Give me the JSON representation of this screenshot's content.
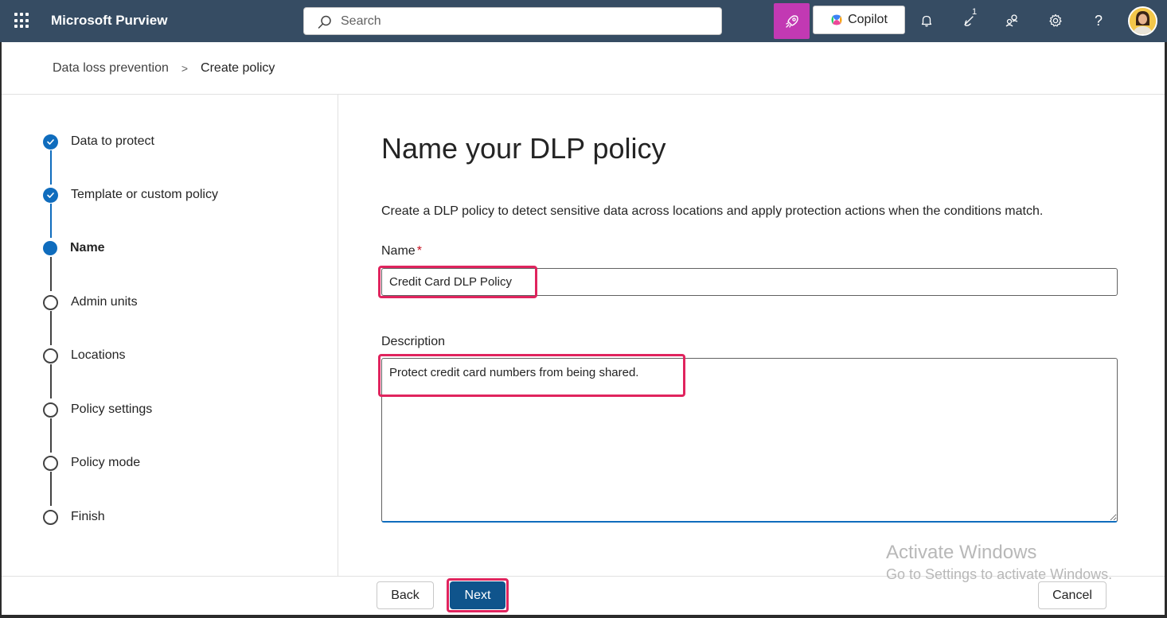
{
  "header": {
    "app_name": "Microsoft Purview",
    "search_placeholder": "Search",
    "copilot_label": "Copilot",
    "notification_badge": "1",
    "accent_color": "#c239b3"
  },
  "breadcrumb": {
    "items": [
      "Data loss prevention",
      "Create policy"
    ],
    "separator": ">"
  },
  "wizard": {
    "steps": [
      {
        "label": "Data to protect",
        "status": "completed"
      },
      {
        "label": "Template or custom policy",
        "status": "completed"
      },
      {
        "label": "Name",
        "status": "current"
      },
      {
        "label": "Admin units",
        "status": "pending"
      },
      {
        "label": "Locations",
        "status": "pending"
      },
      {
        "label": "Policy settings",
        "status": "pending"
      },
      {
        "label": "Policy mode",
        "status": "pending"
      },
      {
        "label": "Finish",
        "status": "pending"
      }
    ]
  },
  "main": {
    "title": "Name your DLP policy",
    "description": "Create a DLP policy to detect sensitive data across locations and apply protection actions when the conditions match.",
    "name_label": "Name",
    "required_marker": "*",
    "name_value": "Credit Card DLP Policy",
    "description_label": "Description",
    "description_value": "Protect credit card numbers from being shared."
  },
  "footer": {
    "back_label": "Back",
    "next_label": "Next",
    "cancel_label": "Cancel"
  },
  "watermark": {
    "line1": "Activate Windows",
    "line2": "Go to Settings to activate Windows."
  }
}
